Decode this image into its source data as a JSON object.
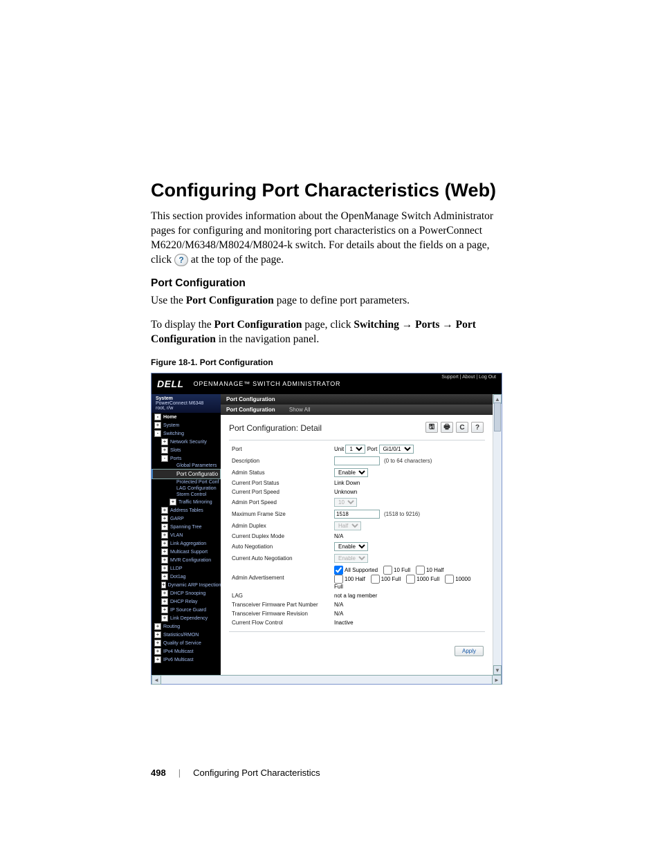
{
  "doc": {
    "title": "Configuring Port Characteristics (Web)",
    "intro_a": "This section provides information about the OpenManage Switch Administrator pages for configuring and monitoring port characteristics on a PowerConnect M6220/M6348/M8024/M8024-k switch. For details about the fields on a page, click ",
    "intro_b": " at the top of the page.",
    "help_glyph": "?",
    "subhead": "Port Configuration",
    "p1_a": "Use the ",
    "p1_b": "Port Configuration",
    "p1_c": " page to define port parameters.",
    "p2_a": "To display the ",
    "p2_b": "Port Configuration",
    "p2_c": " page, click ",
    "p2_d": "Switching",
    "p2_e": "Ports",
    "p2_f": "Port Configuration",
    "p2_g": " in the navigation panel.",
    "arrow": " → ",
    "fig_caption": "Figure 18-1.    Port Configuration"
  },
  "shot": {
    "logo": "DELL",
    "logo_tag": "OPENMANAGE™ SWITCH ADMINISTRATOR",
    "top_links": "Support  |  About  |  Log Out",
    "sidebar": {
      "sys_title": "System",
      "sys_model": "PowerConnect M6348",
      "sys_user": "root, r/w",
      "items": [
        {
          "lvl": 0,
          "box": "minus",
          "label": "Home",
          "top": true
        },
        {
          "lvl": 0,
          "box": "plus",
          "label": "System"
        },
        {
          "lvl": 0,
          "box": "minus",
          "label": "Switching"
        },
        {
          "lvl": 1,
          "box": "plus",
          "label": "Network Security"
        },
        {
          "lvl": 1,
          "box": "plus",
          "label": "Slots"
        },
        {
          "lvl": 1,
          "box": "minus",
          "label": "Ports"
        },
        {
          "lvl": 3,
          "box": "",
          "label": "Global Parameters"
        },
        {
          "lvl": 3,
          "box": "",
          "label": "Port Configuratio",
          "sel": true
        },
        {
          "lvl": 3,
          "box": "",
          "label": "Protected Port Conf"
        },
        {
          "lvl": 3,
          "box": "",
          "label": "LAG Configuration"
        },
        {
          "lvl": 3,
          "box": "",
          "label": "Storm Control"
        },
        {
          "lvl": 2,
          "box": "plus",
          "label": "Traffic Mirroring"
        },
        {
          "lvl": 1,
          "box": "plus",
          "label": "Address Tables"
        },
        {
          "lvl": 1,
          "box": "plus",
          "label": "GARP"
        },
        {
          "lvl": 1,
          "box": "plus",
          "label": "Spanning Tree"
        },
        {
          "lvl": 1,
          "box": "plus",
          "label": "VLAN"
        },
        {
          "lvl": 1,
          "box": "plus",
          "label": "Link Aggregation"
        },
        {
          "lvl": 1,
          "box": "plus",
          "label": "Multicast Support"
        },
        {
          "lvl": 1,
          "box": "plus",
          "label": "MVR Configuration"
        },
        {
          "lvl": 1,
          "box": "plus",
          "label": "LLDP"
        },
        {
          "lvl": 1,
          "box": "plus",
          "label": "Dot1ag"
        },
        {
          "lvl": 1,
          "box": "plus",
          "label": "Dynamic ARP Inspection"
        },
        {
          "lvl": 1,
          "box": "plus",
          "label": "DHCP Snooping"
        },
        {
          "lvl": 1,
          "box": "plus",
          "label": "DHCP Relay"
        },
        {
          "lvl": 1,
          "box": "plus",
          "label": "IP Source Guard"
        },
        {
          "lvl": 1,
          "box": "plus",
          "label": "Link Dependency"
        },
        {
          "lvl": 0,
          "box": "plus",
          "label": "Routing"
        },
        {
          "lvl": 0,
          "box": "plus",
          "label": "Statistics/RMON"
        },
        {
          "lvl": 0,
          "box": "plus",
          "label": "Quality of Service"
        },
        {
          "lvl": 0,
          "box": "plus",
          "label": "IPv4 Multicast"
        },
        {
          "lvl": 0,
          "box": "plus",
          "label": "IPv6 Multicast"
        }
      ]
    },
    "crumb": "Port Configuration",
    "tabs": {
      "active": "Port Configuration",
      "inactive": "Show All"
    },
    "pane_title": "Port Configuration: Detail",
    "toolbar_glyphs": {
      "save": "🖫",
      "print": "🖶",
      "refresh": "C",
      "help": "?"
    },
    "form": {
      "port": {
        "label": "Port",
        "unit_label": "Unit",
        "unit_value": "1",
        "port_label": "Port",
        "port_value": "Gi1/0/1"
      },
      "description": {
        "label": "Description",
        "value": "",
        "hint": "(0 to 64 characters)"
      },
      "admin_status": {
        "label": "Admin Status",
        "value": "Enable"
      },
      "current_port_status": {
        "label": "Current Port Status",
        "value": "Link Down"
      },
      "current_port_speed": {
        "label": "Current Port Speed",
        "value": "Unknown"
      },
      "admin_port_speed": {
        "label": "Admin Port Speed",
        "value": "10"
      },
      "max_frame": {
        "label": "Maximum Frame Size",
        "value": "1518",
        "hint": "(1518 to 9216)"
      },
      "admin_duplex": {
        "label": "Admin Duplex",
        "value": "Half"
      },
      "current_duplex": {
        "label": "Current Duplex Mode",
        "value": "N/A"
      },
      "auto_neg": {
        "label": "Auto Negotiation",
        "value": "Enable"
      },
      "cur_auto_neg": {
        "label": "Current Auto Negotiation",
        "value": "Enable"
      },
      "admin_adv": {
        "label": "Admin Advertisement",
        "opts": [
          "All Supported",
          "10 Full",
          "10 Half",
          "100 Half",
          "100 Full",
          "1000 Full",
          "10000 Full"
        ],
        "checked": [
          true,
          false,
          false,
          false,
          false,
          false,
          false
        ]
      },
      "lag": {
        "label": "LAG",
        "value": "not a lag member"
      },
      "fw_part": {
        "label": "Transceiver Firmware Part Number",
        "value": "N/A"
      },
      "fw_rev": {
        "label": "Transceiver Firmware Revision",
        "value": "N/A"
      },
      "flow": {
        "label": "Current Flow Control",
        "value": "Inactive"
      }
    },
    "apply": "Apply"
  },
  "footer": {
    "page_num": "498",
    "section": "Configuring Port Characteristics"
  }
}
